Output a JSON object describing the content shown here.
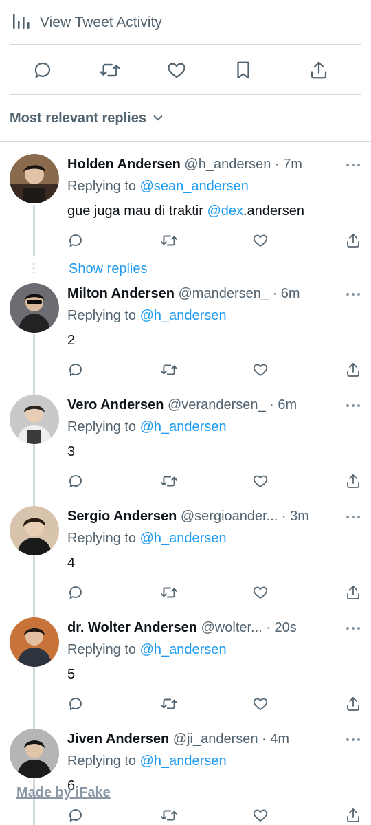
{
  "activity": {
    "label": "View Tweet Activity",
    "icon": "bar-chart-icon"
  },
  "actions": [
    {
      "name": "reply",
      "icon": "comment-icon"
    },
    {
      "name": "retweet",
      "icon": "retweet-icon"
    },
    {
      "name": "like",
      "icon": "heart-icon"
    },
    {
      "name": "bookmark",
      "icon": "bookmark-icon"
    },
    {
      "name": "share",
      "icon": "share-icon"
    }
  ],
  "sort": {
    "label": "Most relevant replies",
    "icon": "chevron-down-icon"
  },
  "show_replies": "Show replies",
  "replying_prefix": "Replying to",
  "colors": {
    "accent": "#1d9bf0",
    "muted": "#536471",
    "divider": "#cfd9de",
    "text": "#0f1419"
  },
  "replies": [
    {
      "name": "Holden Andersen",
      "handle": "@h_andersen",
      "time": "7m",
      "replying_to": "@sean_andersen",
      "text_before": "gue juga mau di traktir ",
      "text_mention": "@dex",
      "text_after": ".andersen"
    },
    {
      "name": "Milton Andersen",
      "handle": "@mandersen_",
      "time": "6m",
      "replying_to": "@h_andersen",
      "text_before": "2",
      "text_mention": "",
      "text_after": ""
    },
    {
      "name": "Vero Andersen",
      "handle": "@verandersen_",
      "time": "6m",
      "replying_to": "@h_andersen",
      "text_before": "3",
      "text_mention": "",
      "text_after": ""
    },
    {
      "name": "Sergio Andersen",
      "handle": "@sergioander...",
      "time": "3m",
      "replying_to": "@h_andersen",
      "text_before": "4",
      "text_mention": "",
      "text_after": ""
    },
    {
      "name": "dr. Wolter Andersen",
      "handle": "@wolter...",
      "time": "20s",
      "replying_to": "@h_andersen",
      "text_before": "5",
      "text_mention": "",
      "text_after": ""
    },
    {
      "name": "Jiven Andersen",
      "handle": "@ji_andersen",
      "time": "4m",
      "replying_to": "@h_andersen",
      "text_before": "6",
      "text_mention": "",
      "text_after": ""
    }
  ],
  "watermark": "Made by iFake"
}
